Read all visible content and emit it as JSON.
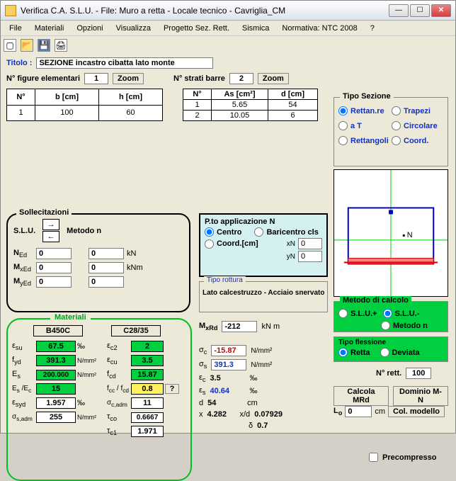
{
  "window_title": "Verifica C.A. S.L.U. - File: Muro a retta - Locale tecnico - Cavriglia_CM",
  "menu": [
    "File",
    "Materiali",
    "Opzioni",
    "Visualizza",
    "Progetto Sez. Rett.",
    "Sismica",
    "Normativa: NTC 2008",
    "?"
  ],
  "titolo_label": "Titolo :",
  "titolo_value": "SEZIONE incastro cibatta lato monte",
  "nfig_label": "N° figure elementari",
  "nfig_value": "1",
  "zoom_label": "Zoom",
  "nstrati_label": "N° strati barre",
  "nstrati_value": "2",
  "fig_table": {
    "headers": [
      "N°",
      "b [cm]",
      "h [cm]"
    ],
    "rows": [
      [
        "1",
        "100",
        "60"
      ]
    ]
  },
  "bar_table": {
    "headers": [
      "N°",
      "As [cm²]",
      "d [cm]"
    ],
    "rows": [
      [
        "1",
        "5.65",
        "54"
      ],
      [
        "2",
        "10.05",
        "6"
      ]
    ]
  },
  "soll": {
    "legend": "Sollecitazioni",
    "slu_label": "S.L.U.",
    "metodo_label": "Metodo n",
    "ned_label": "N",
    "ned_sub": "Ed",
    "mxed_label": "M",
    "mxed_sub": "xEd",
    "myed_label": "M",
    "myed_sub": "yEd",
    "ned": "0",
    "mxed": "0",
    "myed": "0",
    "c2": "0",
    "c2u": "kN",
    "c3": "0",
    "c3u": "kNm",
    "c4": "0"
  },
  "pto": {
    "legend": "P.to applicazione N",
    "centro": "Centro",
    "bari": "Baricentro cls",
    "coord": "Coord.[cm]",
    "xn_label": "xN",
    "xn": "0",
    "yn_label": "yN",
    "yn": "0"
  },
  "rottura": {
    "legend": "Tipo rottura",
    "text": "Lato calcestruzzo - Acciaio snervato"
  },
  "mat": {
    "legend": "Materiali",
    "hdr1": "B450C",
    "hdr2": "C28/35",
    "rows": {
      "esu_l": "ε",
      "esu_s": "su",
      "esu_v": "67.5",
      "esu_u": "‰",
      "ec2_l": "ε",
      "ec2_s": "c2",
      "ec2_v": "2",
      "fyd_l": "f",
      "fyd_s": "yd",
      "fyd_v": "391.3",
      "fyd_u": "N/mm²",
      "ecu_l": "ε",
      "ecu_s": "cu",
      "ecu_v": "3.5",
      "es_l": "E",
      "es_s": "s",
      "es_v": "200.000",
      "es_u": "N/mm²",
      "fcd_l": "f",
      "fcd_s": "cd",
      "fcd_v": "15.87",
      "esec_l": "E",
      "esec_s": "s",
      "esec_l2": " /E",
      "esec_s2": "c",
      "esec_v": "15",
      "fcc_l": "f",
      "fcc_s": "cc",
      "fcc_l2": " / f",
      "fcc_s2": "cd",
      "fcc_v": "0.8",
      "esyd_l": "ε",
      "esyd_s": "syd",
      "esyd_v": "1.957",
      "esyd_u": "‰",
      "scadm_l": "σ",
      "scadm_s": "c,adm",
      "scadm_v": "11",
      "ssadm_l": "σ",
      "ssadm_s": "s,adm",
      "ssadm_v": "255",
      "ssadm_u": "N/mm²",
      "tco_l": "τ",
      "tco_s": "co",
      "tco_v": "0.6667",
      "tc1_l": "τ",
      "tc1_s": "c1",
      "tc1_v": "1.971"
    }
  },
  "results": {
    "mxrd_label": "M",
    "mxrd_sub": "xRd",
    "mxrd": "-212",
    "mxrd_u": "kN m",
    "sc_l": "σ",
    "sc_s": "c",
    "sc_v": "-15.87",
    "sc_u": "N/mm²",
    "ss_l": "σ",
    "ss_s": "s",
    "ss_v": "391.3",
    "ss_u": "N/mm²",
    "ec_l": "ε",
    "ec_s": "c",
    "ec_v": "3.5",
    "ec_u": "‰",
    "es_l": "ε",
    "es_s": "s",
    "es_v": "40.64",
    "es_u": "‰",
    "d_l": "d",
    "d_v": "54",
    "d_u": "cm",
    "x_l": "x",
    "x_v": "4.282",
    "xd_l": "x/d",
    "xd_v": "0.07929",
    "delta_l": "δ",
    "delta_v": "0.7"
  },
  "sez": {
    "legend": "Tipo Sezione",
    "r1": "Rettan.re",
    "r2": "Trapezi",
    "r3": "a T",
    "r4": "Circolare",
    "r5": "Rettangoli",
    "r6": "Coord."
  },
  "calc": {
    "legend": "Metodo di calcolo",
    "r1": "S.L.U.+",
    "r2": "S.L.U.-",
    "r3": "Metodo n"
  },
  "fless": {
    "legend": "Tipo flessione",
    "r1": "Retta",
    "r2": "Deviata"
  },
  "nrett_label": "N° rett.",
  "nrett": "100",
  "btn_calcola": "Calcola MRd",
  "btn_dominio": "Dominio M-N",
  "lo_label": "L",
  "lo_sub": "o",
  "lo_v": "0",
  "lo_u": "cm",
  "btn_col": "Col. modello",
  "precomp": "Precompresso",
  "preview_N": "N"
}
